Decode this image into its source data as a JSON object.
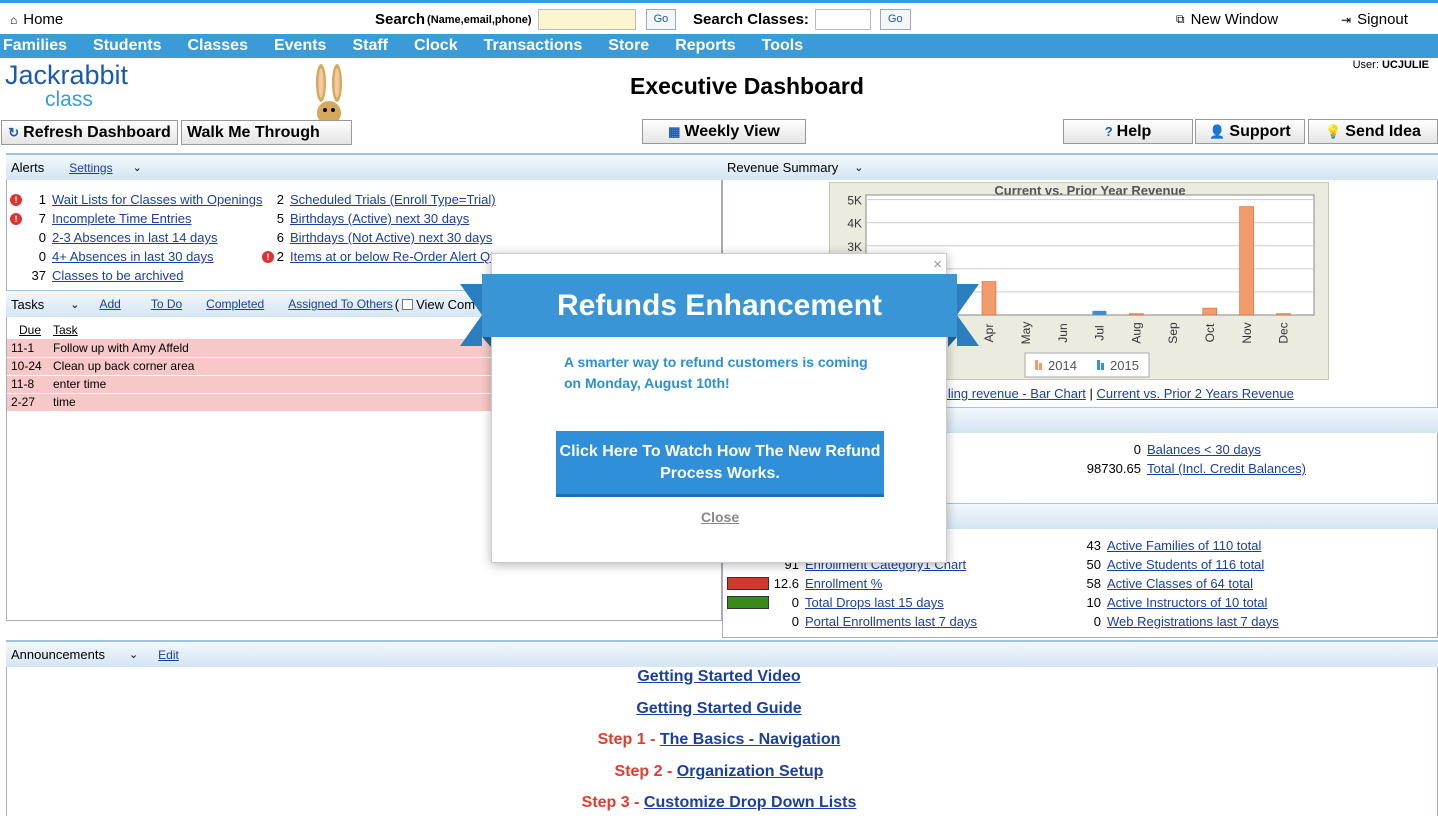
{
  "topbar": {
    "home": "Home",
    "search_label": "Search",
    "search_hint": "(Name,email,phone)",
    "go": "Go",
    "search_classes_label": "Search Classes:",
    "new_window": "New Window",
    "signout": "Signout"
  },
  "nav": [
    "Families",
    "Students",
    "Classes",
    "Events",
    "Staff",
    "Clock",
    "Transactions",
    "Store",
    "Reports",
    "Tools"
  ],
  "logo": {
    "line1": "Jackrabbit",
    "line2": "class"
  },
  "header": {
    "title": "Executive Dashboard",
    "user_label": "User:",
    "user_name": "UCJULIE"
  },
  "buttons": {
    "refresh": "Refresh Dashboard",
    "walk": "Walk Me Through",
    "weekly": "Weekly View",
    "help": "Help",
    "support": "Support",
    "idea": "Send Idea"
  },
  "alerts": {
    "title": "Alerts",
    "settings": "Settings",
    "left": [
      {
        "flag": true,
        "count": "1",
        "label": "Wait Lists for Classes with Openings"
      },
      {
        "flag": true,
        "count": "7",
        "label": "Incomplete Time Entries"
      },
      {
        "flag": false,
        "count": "0",
        "label": "2-3 Absences in last 14 days"
      },
      {
        "flag": false,
        "count": "0",
        "label": "4+ Absences in last 30 days"
      },
      {
        "flag": false,
        "count": "37",
        "label": "Classes to be archived"
      }
    ],
    "right": [
      {
        "flag": false,
        "count": "2",
        "label": "Scheduled Trials (Enroll Type=Trial)"
      },
      {
        "flag": false,
        "count": "5",
        "label": "Birthdays (Active) next 30 days"
      },
      {
        "flag": false,
        "count": "6",
        "label": "Birthdays (Not Active) next 30 days"
      },
      {
        "flag": true,
        "count": "2",
        "label": "Items at or below Re-Order Alert Qty"
      }
    ]
  },
  "tasks": {
    "title": "Tasks",
    "add": "Add",
    "todo": "To Do",
    "completed": "Completed",
    "assigned": "Assigned To Others",
    "view_completed": "View Com",
    "col_due": "Due",
    "col_task": "Task",
    "rows": [
      {
        "due": "11-1",
        "task": "Follow up with Amy Affeld"
      },
      {
        "due": "10-24",
        "task": "Clean up back corner area"
      },
      {
        "due": "11-8",
        "task": "enter time"
      },
      {
        "due": "2-27",
        "task": "time"
      }
    ]
  },
  "revenue": {
    "title": "Revenue Summary",
    "link1": "iling revenue - Bar Chart",
    "sep": "|",
    "link2": "Current vs. Prior 2 Years Revenue"
  },
  "chart_data": {
    "type": "bar",
    "title": "Current vs. Prior Year Revenue",
    "categories": [
      "Apr",
      "May",
      "Jun",
      "Jul",
      "Aug",
      "Sep",
      "Oct",
      "Nov",
      "Dec"
    ],
    "yticks": [
      "5K",
      "4K",
      "3K"
    ],
    "ylim": [
      0,
      5200
    ],
    "series": [
      {
        "name": "2014",
        "color": "#f29b6b",
        "values": [
          1450,
          0,
          0,
          0,
          60,
          0,
          300,
          4700,
          60
        ]
      },
      {
        "name": "2015",
        "color": "#3a8fd6",
        "values": [
          0,
          0,
          0,
          180,
          0,
          0,
          0,
          0,
          0
        ]
      }
    ]
  },
  "balances": [
    {
      "n": "0",
      "label": "Balances < 30 days"
    },
    {
      "n": "98730.65",
      "label": "Total (Incl. Credit Balances)"
    }
  ],
  "enroll_left": [
    {
      "n": "91",
      "label": "Enrollment Category1 Chart",
      "bar": ""
    },
    {
      "n": "12.6",
      "label": "Enrollment %",
      "bar": "#d03a2a"
    },
    {
      "n": "0",
      "label": "Total Drops last 15 days",
      "bar": "#3a8a1a"
    },
    {
      "n": "0",
      "label": "Portal Enrollments last 7 days",
      "bar": ""
    }
  ],
  "enroll_right": [
    {
      "n": "43",
      "label": "Active Families of 110 total"
    },
    {
      "n": "50",
      "label": "Active Students of 116 total"
    },
    {
      "n": "58",
      "label": "Active Classes of 64 total"
    },
    {
      "n": "10",
      "label": "Active Instructors of 10 total"
    },
    {
      "n": "0",
      "label": "Web Registrations last 7 days"
    }
  ],
  "announcements": {
    "title": "Announcements",
    "edit": "Edit",
    "video": "Getting Started Video",
    "guide": "Getting Started Guide",
    "steps": [
      {
        "step": "Step 1 -",
        "link": "The Basics - Navigation"
      },
      {
        "step": "Step 2 -",
        "link": "Organization Setup"
      },
      {
        "step": "Step 3 -",
        "link": "Customize Drop Down Lists"
      }
    ]
  },
  "modal": {
    "title": "Refunds Enhancement",
    "text": "A smarter way to refund customers is coming on Monday, August 10th!",
    "cta": "Click Here To Watch How The New Refund Process Works.",
    "close": "Close",
    "x": "×"
  }
}
